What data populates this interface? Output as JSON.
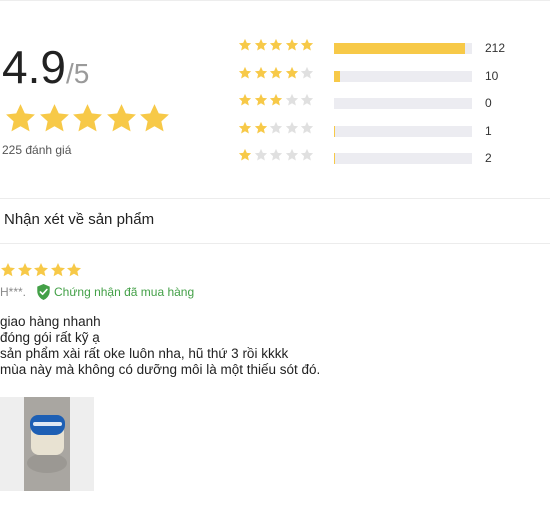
{
  "rating": {
    "average": "4.9",
    "max": "/5",
    "total_label": "225 đánh giá",
    "average_stars": 5,
    "distribution": [
      {
        "stars": 5,
        "count": "212",
        "fraction": 0.95
      },
      {
        "stars": 4,
        "count": "10",
        "fraction": 0.045
      },
      {
        "stars": 3,
        "count": "0",
        "fraction": 0
      },
      {
        "stars": 2,
        "count": "1",
        "fraction": 0.006
      },
      {
        "stars": 1,
        "count": "2",
        "fraction": 0.009
      }
    ]
  },
  "reviews_section": {
    "title": "Nhận xét về sản phẩm"
  },
  "review": {
    "stars": 5,
    "author": "H***.",
    "verified_label": "Chứng nhận đã mua hàng",
    "lines": [
      "giao hàng nhanh",
      "đóng gói rất kỹ ạ",
      "sản phẩm xài rất oke luôn nha, hũ thứ 3 rồi kkkk",
      "mùa này mà không có dưỡng môi là một thiếu sót đó."
    ],
    "photo_icon": "product-photo"
  },
  "colors": {
    "star_filled": "#f7c948",
    "star_empty": "#e0e0e0",
    "bar_fill": "#f7c948",
    "bar_track": "#ececf1",
    "verified": "#43a047"
  }
}
